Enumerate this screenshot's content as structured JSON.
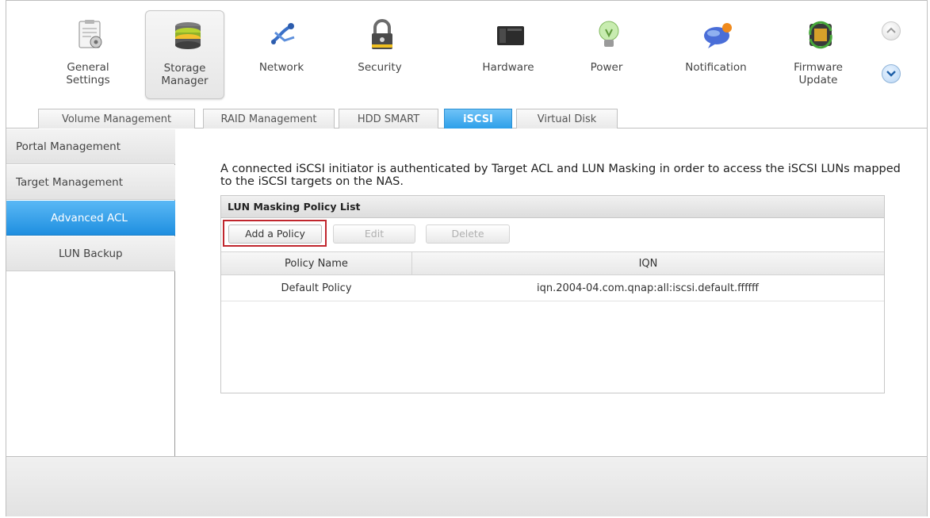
{
  "toolbar": {
    "items": [
      {
        "label": "General\nSettings",
        "icon": "general-settings-icon"
      },
      {
        "label": "Storage\nManager",
        "icon": "storage-manager-icon",
        "active": true
      },
      {
        "label": "Network",
        "icon": "network-icon"
      },
      {
        "label": "Security",
        "icon": "lock-icon"
      },
      {
        "label": "Hardware",
        "icon": "hardware-icon"
      },
      {
        "label": "Power",
        "icon": "lightbulb-icon"
      },
      {
        "label": "Notification",
        "icon": "notification-icon"
      },
      {
        "label": "Firmware\nUpdate",
        "icon": "firmware-chip-icon"
      }
    ],
    "scroll_up_icon": "chevron-up-icon",
    "scroll_down_icon": "chevron-down-icon"
  },
  "tabs": [
    {
      "label": "Volume Management"
    },
    {
      "label": "RAID Management"
    },
    {
      "label": "HDD SMART"
    },
    {
      "label": "iSCSI",
      "active": true
    },
    {
      "label": "Virtual Disk"
    }
  ],
  "sidebar": {
    "items": [
      {
        "label": "Portal Management"
      },
      {
        "label": "Target Management"
      },
      {
        "label": "Advanced ACL",
        "active": true
      },
      {
        "label": "LUN Backup"
      }
    ]
  },
  "main": {
    "description": "A connected iSCSI initiator is authenticated by Target ACL and LUN Masking in order to access the iSCSI LUNs mapped to the iSCSI targets on the NAS.",
    "panel_title": "LUN Masking Policy List",
    "buttons": {
      "add": "Add a Policy",
      "edit": "Edit",
      "delete": "Delete"
    },
    "table": {
      "columns": [
        "Policy Name",
        "IQN"
      ],
      "rows": [
        [
          "Default Policy",
          "iqn.2004-04.com.qnap:all:iscsi.default.ffffff"
        ]
      ]
    }
  },
  "colors": {
    "accent_blue": "#2d9fe9",
    "highlight_red": "#c0262d"
  }
}
